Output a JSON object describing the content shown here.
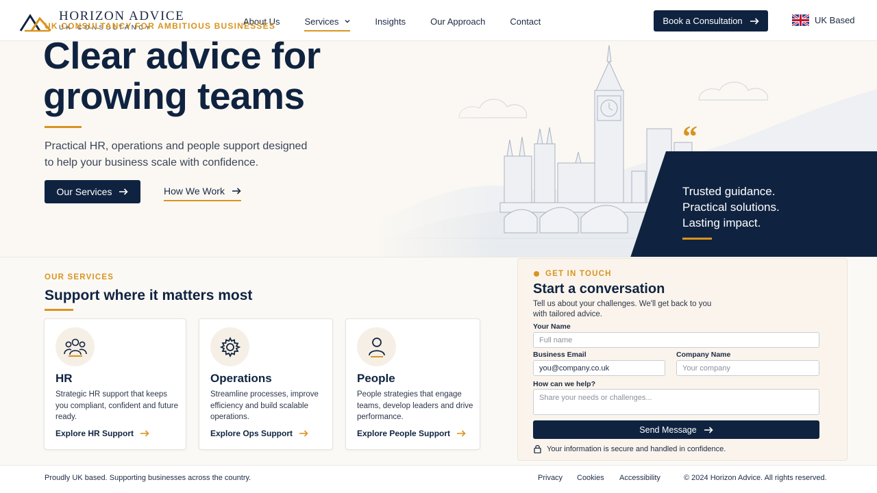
{
  "brand": {
    "name": "HORIZON ADVICE",
    "tagline": "UK CONSULTANCY"
  },
  "nav": {
    "items": [
      "About Us",
      "Services",
      "Insights",
      "Our Approach",
      "Contact"
    ],
    "active": "Services",
    "cta": "Book a Consultation",
    "region": "UK Based"
  },
  "hero": {
    "eyebrow": "UK CONSULTANCY FOR AMBITIOUS BUSINESSES",
    "title": "Clear advice for\ngrowing teams",
    "description": "Practical HR, operations and people support designed to help your business scale with confidence.",
    "primary_button": "Our Services",
    "secondary_button": "How We Work",
    "quote": {
      "mark": "“",
      "lines": [
        "Trusted guidance.",
        "Practical solutions.",
        "Lasting impact."
      ]
    }
  },
  "services": {
    "eyebrow": "OUR SERVICES",
    "title": "Support where it matters most",
    "cards": [
      {
        "icon": "team-icon",
        "title": "HR",
        "description": "Strategic HR support that keeps you compliant, confident and future ready.",
        "link": "Explore HR Support"
      },
      {
        "icon": "gear-icon",
        "title": "Operations",
        "description": "Streamline processes, improve efficiency and build scalable operations.",
        "link": "Explore Ops Support"
      },
      {
        "icon": "person-icon",
        "title": "People",
        "description": "People strategies that engage teams, develop leaders and drive performance.",
        "link": "Explore People Support"
      }
    ]
  },
  "contact": {
    "eyebrow": "GET IN TOUCH",
    "title": "Start a conversation",
    "description": "Tell us about your challenges. We'll get back to you with tailored advice.",
    "fields": {
      "name": {
        "label": "Your Name",
        "placeholder": "Full name"
      },
      "email": {
        "label": "Business Email",
        "value": "you@company.co.uk"
      },
      "company": {
        "label": "Company Name",
        "placeholder": "Your company"
      },
      "help": {
        "label": "How can we help?",
        "placeholder": "Share your needs or challenges..."
      }
    },
    "submit": "Send Message",
    "secure_note": "Your information is secure and handled in confidence."
  },
  "footer": {
    "tagline": "Proudly UK based. Supporting businesses across the country.",
    "links": [
      "Privacy",
      "Cookies",
      "Accessibility"
    ],
    "copyright": "© 2024 Horizon Advice. All rights reserved."
  },
  "colors": {
    "navy": "#0f2340",
    "accent": "#d9941e",
    "background": "#fbf8f3"
  }
}
